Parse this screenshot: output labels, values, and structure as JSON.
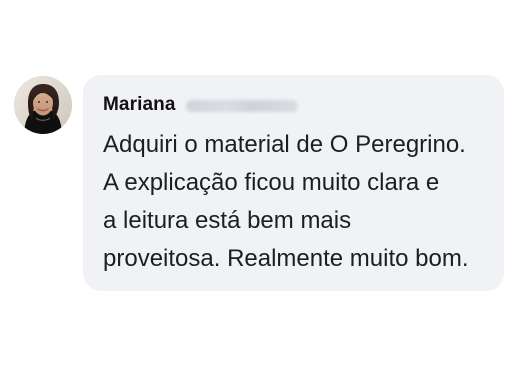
{
  "comment": {
    "author": {
      "first_name": "Mariana",
      "surname_obscured": true,
      "avatar_icon": "user-photo-avatar"
    },
    "text": "Adquiri o material de O Peregrino.\nA explicação ficou muito clara e\na leitura está bem mais\nproveitosa. Realmente muito bom.",
    "colors": {
      "bubble_bg": "#f0f2f5",
      "text": "#1c1e21",
      "name": "#111111"
    }
  }
}
